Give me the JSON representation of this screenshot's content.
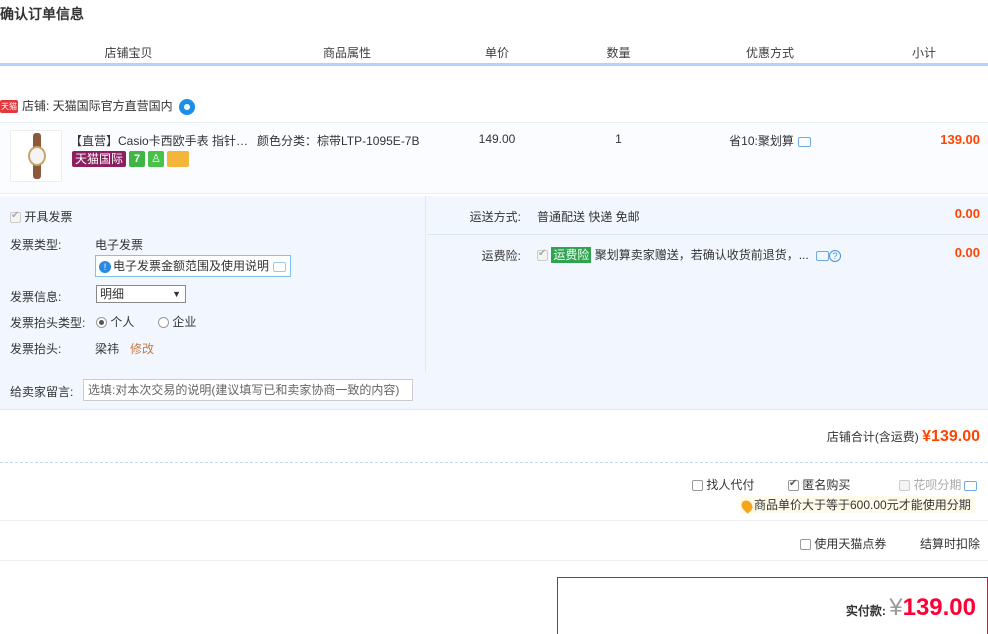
{
  "page_title": "确认订单信息",
  "columns": [
    "店铺宝贝",
    "商品属性",
    "单价",
    "数量",
    "优惠方式",
    "小计"
  ],
  "shop": {
    "badge": "天猫",
    "label": "店铺: 天猫国际官方直营国内"
  },
  "item": {
    "title": "【直营】Casio卡西欧手表 指针…",
    "tag_intl": "天猫国际",
    "tag_seven": "7",
    "attr": "颜色分类：棕带LTP-1095E-7B",
    "unit_price": "149.00",
    "quantity": "1",
    "discount": "省10:聚划算",
    "subtotal": "139.00"
  },
  "invoice": {
    "open_label": "开具发票",
    "type_label": "发票类型:",
    "type_value": "电子发票",
    "notice": "电子发票金额范围及使用说明",
    "info_label": "发票信息:",
    "info_value": "明细",
    "header_type_label": "发票抬头类型:",
    "header_type_options": [
      "个人",
      "企业"
    ],
    "header_label": "发票抬头:",
    "header_value": "梁祎",
    "modify_link": "修改"
  },
  "shipping": {
    "label": "运送方式:",
    "value": "普通配送 快递 免邮",
    "price": "0.00"
  },
  "insurance": {
    "label": "运费险:",
    "tag": "运费险",
    "text": "聚划算卖家赠送，若确认收货前退货，...",
    "price": "0.00"
  },
  "message": {
    "label": "给卖家留言:",
    "placeholder": "选填:对本次交易的说明(建议填写已和卖家协商一致的内容)"
  },
  "shop_total": {
    "label": "店铺合计(含运费)",
    "value": "¥139.00"
  },
  "options": {
    "proxy_pay": "找人代付",
    "anonymous": "匿名购买",
    "huabei": "花呗分期",
    "huabei_note": "商品单价大于等于600.00元才能使用分期"
  },
  "coupon": {
    "label": "使用天猫点券",
    "note": "结算时扣除"
  },
  "payment": {
    "label": "实付款:",
    "currency": "¥",
    "amount": "139.00"
  },
  "colors": {
    "price_red": "#ff4400",
    "pay_red": "#ff0036",
    "section_bg": "#f2f7ff",
    "header_border": "#b2d1ff"
  }
}
